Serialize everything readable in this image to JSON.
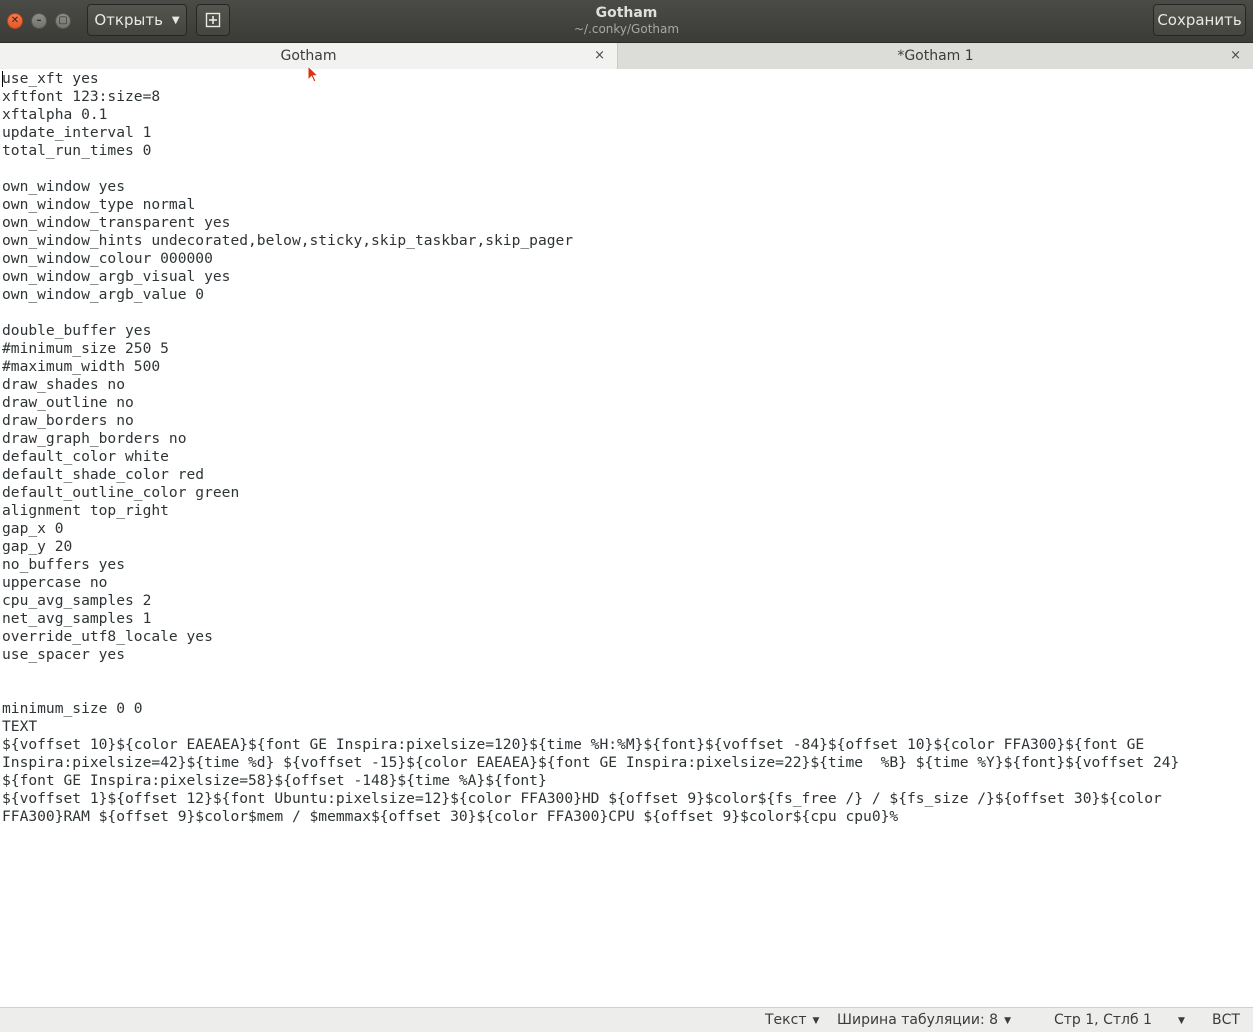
{
  "window": {
    "title": "Gotham",
    "subtitle": "~/.conky/Gotham",
    "open_label": "Открыть",
    "save_label": "Сохранить",
    "close_glyph": "✕",
    "minimize_glyph": "–",
    "maximize_glyph": "▢"
  },
  "tabs": [
    {
      "label": "Gotham",
      "close": "×",
      "active": true
    },
    {
      "label": "*Gotham 1",
      "close": "×",
      "active": false
    }
  ],
  "editor": {
    "lines": [
      "use_xft yes",
      "xftfont 123:size=8",
      "xftalpha 0.1",
      "update_interval 1",
      "total_run_times 0",
      "",
      "own_window yes",
      "own_window_type normal",
      "own_window_transparent yes",
      "own_window_hints undecorated,below,sticky,skip_taskbar,skip_pager",
      "own_window_colour 000000",
      "own_window_argb_visual yes",
      "own_window_argb_value 0",
      "",
      "double_buffer yes",
      "#minimum_size 250 5",
      "#maximum_width 500",
      "draw_shades no",
      "draw_outline no",
      "draw_borders no",
      "draw_graph_borders no",
      "default_color white",
      "default_shade_color red",
      "default_outline_color green",
      "alignment top_right",
      "gap_x 0",
      "gap_y 20",
      "no_buffers yes",
      "uppercase no",
      "cpu_avg_samples 2",
      "net_avg_samples 1",
      "override_utf8_locale yes",
      "use_spacer yes",
      "",
      "",
      "minimum_size 0 0",
      "TEXT",
      "${voffset 10}${color EAEAEA}${font GE Inspira:pixelsize=120}${time %H:%M}${font}${voffset -84}${offset 10}${color FFA300}${font GE",
      "Inspira:pixelsize=42}${time %d} ${voffset -15}${color EAEAEA}${font GE Inspira:pixelsize=22}${time  %B} ${time %Y}${font}${voffset 24}",
      "${font GE Inspira:pixelsize=58}${offset -148}${time %A}${font}",
      "${voffset 1}${offset 12}${font Ubuntu:pixelsize=12}${color FFA300}HD ${offset 9}$color${fs_free /} / ${fs_size /}${offset 30}${color",
      "FFA300}RAM ${offset 9}$color$mem / $memmax${offset 30}${color FFA300}CPU ${offset 9}$color${cpu cpu0}%"
    ]
  },
  "statusbar": {
    "language": "Текст",
    "tab_width": "Ширина табуляции: 8",
    "position": "Стр 1, Стлб 1",
    "insert_mode": "ВСТ",
    "dropdown_glyph": "▼"
  },
  "colors": {
    "titlebar": "#3f3f3c",
    "close_button": "#e95c2c",
    "text": "#2e3436",
    "pointer": "#d8320e"
  }
}
